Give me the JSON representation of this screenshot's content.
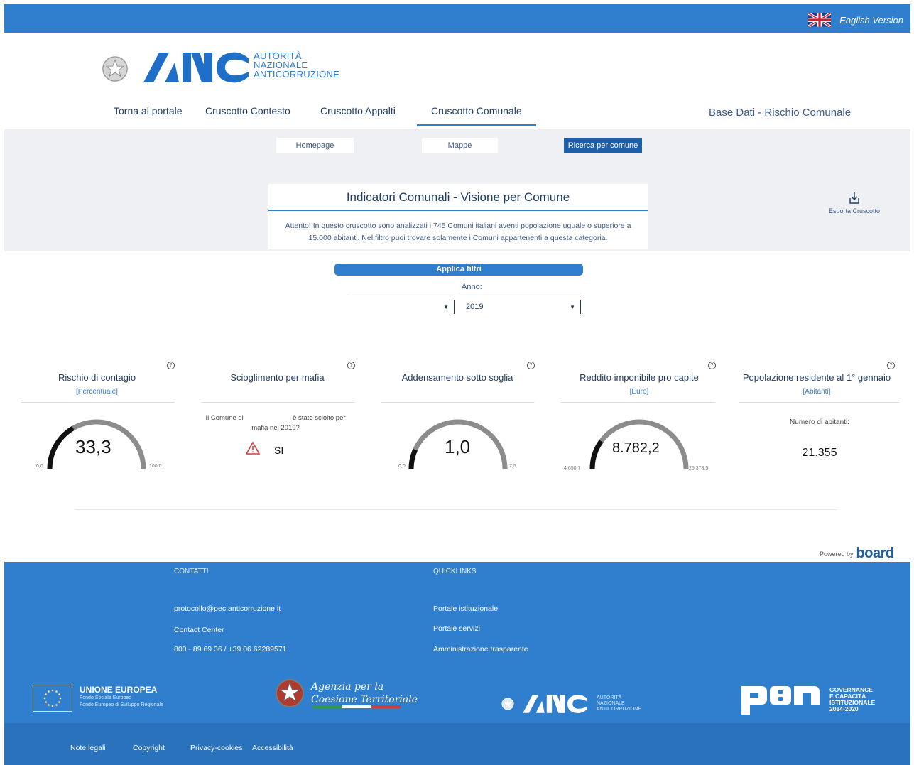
{
  "header": {
    "lang_label": "English Version",
    "anac_text": [
      "AUTORITÀ",
      "NAZIONALE",
      "ANTICORRUZIONE"
    ]
  },
  "nav": {
    "items": [
      "Torna al portale",
      "Cruscotto Contesto",
      "Cruscotto Appalti",
      "Cruscotto Comunale"
    ],
    "active": "Cruscotto Comunale",
    "base_dati": "Base Dati - Rischio Comunale"
  },
  "subnav": {
    "items": [
      "Homepage",
      "Mappe",
      "Ricerca per comune"
    ],
    "active": "Ricerca per comune"
  },
  "main": {
    "title": "Indicatori Comunali - Visione per Comune",
    "notice_line1": "Attento! In questo cruscotto sono analizzati i 745 Comuni italiani aventi popolazione uguale o superiore a",
    "notice_line2": "15.000 abitanti. Nel filtro puoi trovare solamente i Comuni appartenenti a questa categoria.",
    "export_label": "Esporta Cruscotto"
  },
  "filters": {
    "apply_label": "Applica filtri",
    "anno_label": "Anno:",
    "comune_value": "",
    "anno_value": "2019"
  },
  "kpis": {
    "contagio": {
      "title": "Rischio di contagio",
      "unit": "[Percentuale]",
      "value": "33,3",
      "min": "0,0",
      "max": "100,0",
      "fraction": 0.333
    },
    "mafia": {
      "title": "Scioglimento per mafia",
      "text_a": "Il Comune di",
      "text_b": "è stato sciolto per",
      "text_c": "mafia nel 2019?",
      "answer": "SI"
    },
    "addensamento": {
      "title": "Addensamento sotto soglia",
      "value": "1,0",
      "min": "0,0",
      "max": "7,5",
      "fraction": 0.133
    },
    "reddito": {
      "title": "Reddito imponibile pro capite",
      "unit": "[Euro]",
      "value": "8.782,2",
      "min": "4.650,7",
      "max": "25.378,5",
      "fraction": 0.2
    },
    "popolazione": {
      "title": "Popolazione residente al 1° gennaio",
      "unit": "[Abitanti]",
      "label": "Numero di abitanti:",
      "value": "21.355"
    }
  },
  "help_symbol": "?",
  "powered": {
    "label": "Powered by",
    "brand": "board"
  },
  "footer": {
    "contatti_title": "CONTATTI",
    "contatti": [
      "protocollo@pec.anticorruzione.it",
      "Contact Center",
      "800 - 89 69 36 / +39 06 62289571"
    ],
    "quicklinks_title": "QUICKLINKS",
    "quicklinks": [
      "Portale istituzionale",
      "Portale servizi",
      "Amministrazione trasparente"
    ],
    "eu_title": "UNIONE EUROPEA",
    "eu_sub1": "Fondo Sociale Europeo",
    "eu_sub2": "Fondo Europeo di Sviluppo Regionale",
    "agenzia_line1": "Agenzia per la",
    "agenzia_line2": "Coesione Territoriale",
    "anac_text": [
      "AUTORITÀ",
      "NAZIONALE",
      "ANTICORRUZIONE"
    ],
    "pon_text": [
      "GOVERNANCE",
      "E CAPACITÀ",
      "ISTITUZIONALE",
      "2014-2020"
    ],
    "bottom_links": [
      "Note legali",
      "Copyright",
      "Privacy-cookies",
      "Accessibilità"
    ]
  },
  "colors": {
    "primary": "#2f7fce",
    "dark_blue": "#1f3d63",
    "gauge_fill": "#111111",
    "gauge_track": "#8c8c8c"
  }
}
